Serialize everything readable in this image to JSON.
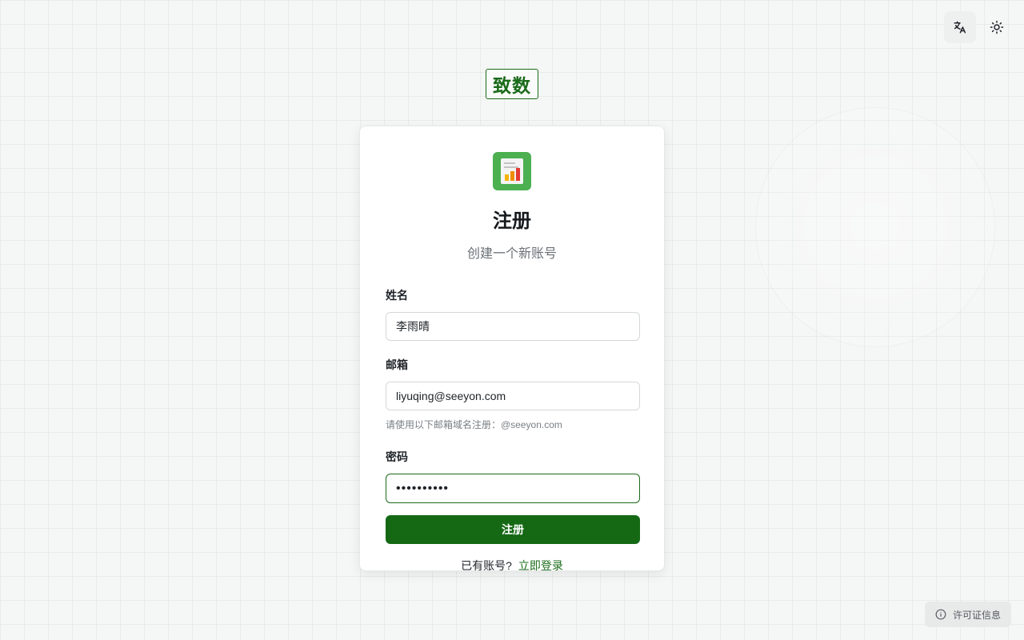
{
  "top_actions": {
    "translate_icon": "translate-icon",
    "theme_icon": "sun-icon"
  },
  "brand": {
    "logo_text": "致数"
  },
  "app": {
    "icon": "spreadsheet-chart-icon",
    "colors": {
      "accent": "#156915",
      "icon_bg": "#4caf50"
    }
  },
  "form": {
    "title": "注册",
    "subtitle": "创建一个新账号",
    "name_label": "姓名",
    "name_value": "李雨晴",
    "email_label": "邮箱",
    "email_value": "liyuqing@seeyon.com",
    "email_hint": "请使用以下邮箱域名注册：@seeyon.com",
    "password_label": "密码",
    "password_value": "••••••••••",
    "submit_label": "注册",
    "have_account_text": "已有账号?",
    "login_link": "立即登录"
  },
  "footer": {
    "license_label": "许可证信息",
    "license_icon": "info-icon"
  }
}
